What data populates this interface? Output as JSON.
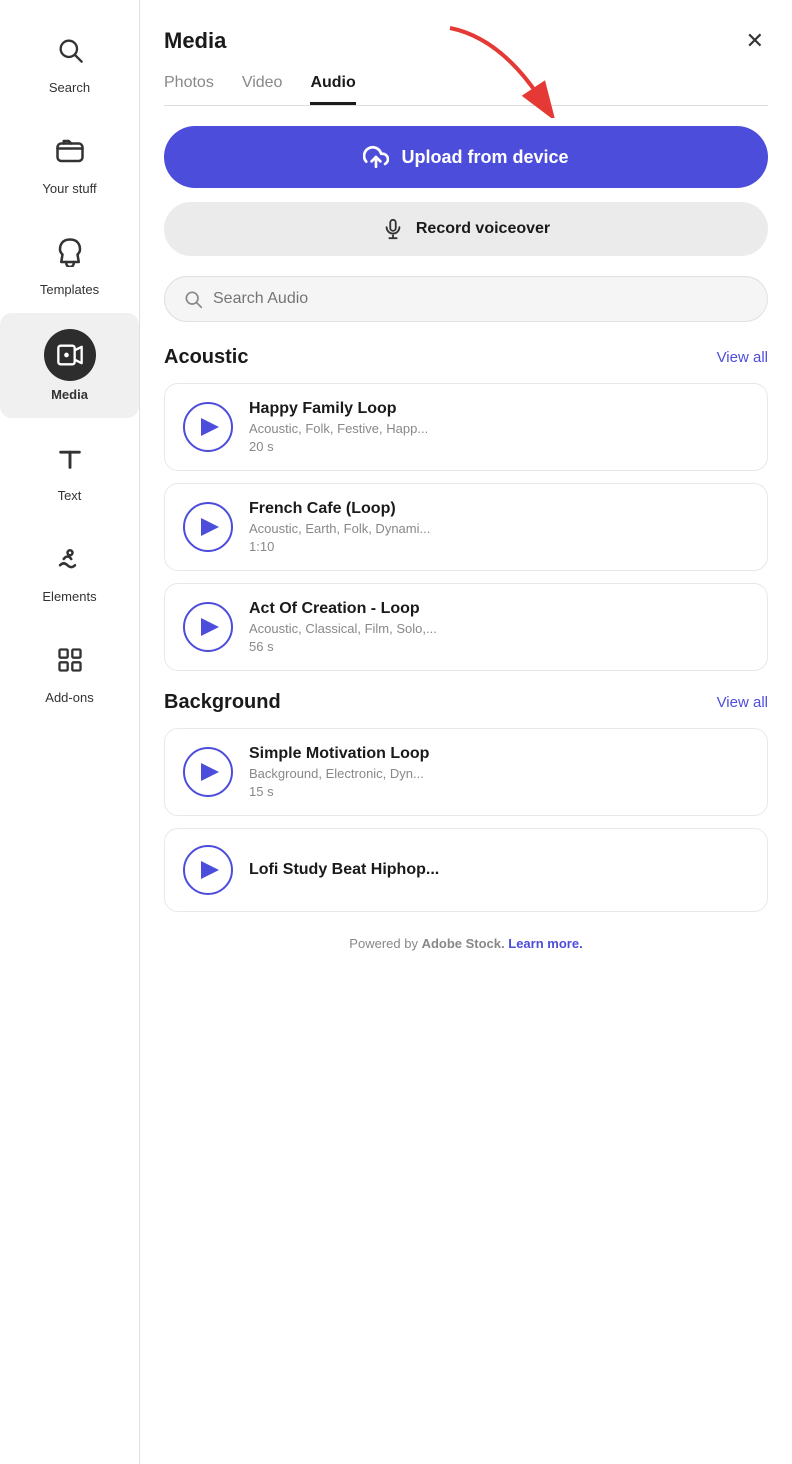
{
  "sidebar": {
    "items": [
      {
        "id": "search",
        "label": "Search",
        "icon": "search",
        "active": false
      },
      {
        "id": "your-stuff",
        "label": "Your stuff",
        "icon": "folder",
        "active": false
      },
      {
        "id": "templates",
        "label": "Templates",
        "icon": "templates",
        "active": false
      },
      {
        "id": "media",
        "label": "Media",
        "icon": "media",
        "active": true
      },
      {
        "id": "text",
        "label": "Text",
        "icon": "text",
        "active": false
      },
      {
        "id": "elements",
        "label": "Elements",
        "icon": "elements",
        "active": false
      },
      {
        "id": "add-ons",
        "label": "Add-ons",
        "icon": "addons",
        "active": false
      }
    ]
  },
  "panel": {
    "title": "Media",
    "tabs": [
      {
        "id": "photos",
        "label": "Photos",
        "active": false
      },
      {
        "id": "video",
        "label": "Video",
        "active": false
      },
      {
        "id": "audio",
        "label": "Audio",
        "active": true
      }
    ],
    "upload_button": "Upload from device",
    "record_button": "Record voiceover",
    "search_placeholder": "Search Audio",
    "sections": [
      {
        "id": "acoustic",
        "title": "Acoustic",
        "view_all_label": "View all",
        "items": [
          {
            "title": "Happy Family Loop",
            "tags": "Acoustic, Folk, Festive, Happ...",
            "duration": "20 s"
          },
          {
            "title": "French Cafe (Loop)",
            "tags": "Acoustic, Earth, Folk, Dynami...",
            "duration": "1:10"
          },
          {
            "title": "Act Of Creation - Loop",
            "tags": "Acoustic, Classical, Film, Solo,...",
            "duration": "56 s"
          }
        ]
      },
      {
        "id": "background",
        "title": "Background",
        "view_all_label": "View all",
        "items": [
          {
            "title": "Simple Motivation Loop",
            "tags": "Background, Electronic, Dyn...",
            "duration": "15 s"
          },
          {
            "title": "Lofi Study Beat Hiphop...",
            "tags": "",
            "duration": ""
          }
        ]
      }
    ],
    "footer": {
      "text": "Powered by ",
      "brand": "Adobe Stock.",
      "link_text": "Learn more.",
      "link": "#"
    }
  }
}
